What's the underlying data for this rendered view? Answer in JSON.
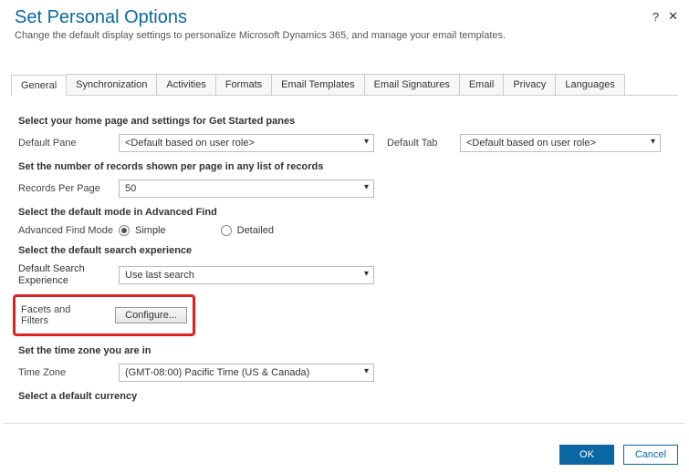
{
  "header": {
    "title": "Set Personal Options",
    "subtitle": "Change the default display settings to personalize Microsoft Dynamics 365, and manage your email templates."
  },
  "icons": {
    "help": "?",
    "close": "✕"
  },
  "tabs": [
    "General",
    "Synchronization",
    "Activities",
    "Formats",
    "Email Templates",
    "Email Signatures",
    "Email",
    "Privacy",
    "Languages"
  ],
  "sections": {
    "homepage": {
      "heading": "Select your home page and settings for Get Started panes",
      "pane_label": "Default Pane",
      "pane_value": "<Default based on user role>",
      "tab_label": "Default Tab",
      "tab_value": "<Default based on user role>"
    },
    "records": {
      "heading": "Set the number of records shown per page in any list of records",
      "label": "Records Per Page",
      "value": "50"
    },
    "findmode": {
      "heading": "Select the default mode in Advanced Find",
      "label": "Advanced Find Mode",
      "opt1": "Simple",
      "opt2": "Detailed"
    },
    "search": {
      "heading": "Select the default search experience",
      "exp_label": "Default Search Experience",
      "exp_value": "Use last search",
      "facets_label": "Facets and Filters",
      "configure_btn": "Configure..."
    },
    "timezone": {
      "heading": "Set the time zone you are in",
      "label": "Time Zone",
      "value": "(GMT-08:00) Pacific Time (US & Canada)"
    },
    "currency": {
      "heading": "Select a default currency"
    }
  },
  "footer": {
    "ok": "OK",
    "cancel": "Cancel"
  }
}
